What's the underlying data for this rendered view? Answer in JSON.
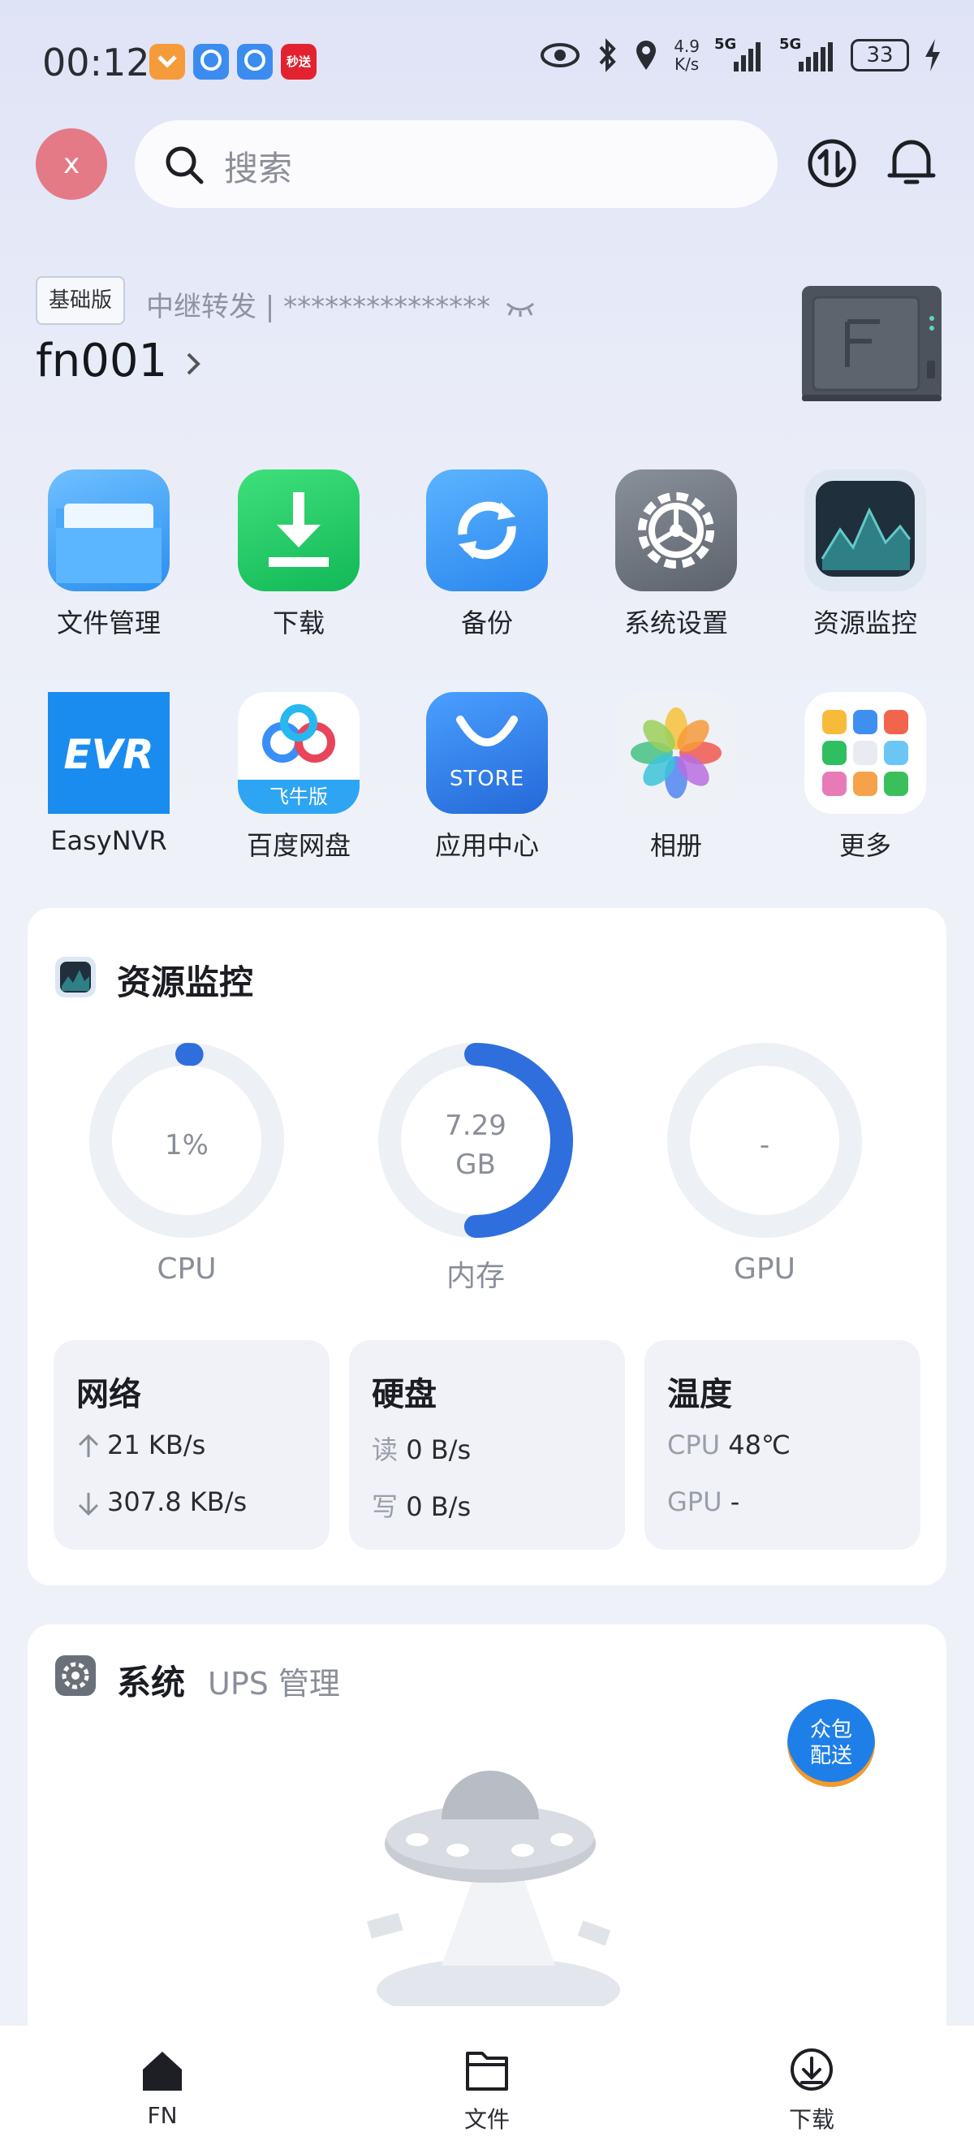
{
  "status_bar": {
    "time": "00:12",
    "apps": [
      {
        "label": "",
        "color": "#f59b3a"
      },
      {
        "label": "",
        "color": "#3c8cf0"
      },
      {
        "label": "",
        "color": "#3c8cf0"
      },
      {
        "label": "秒送",
        "color": "#e3222f"
      }
    ],
    "net_speed_value": "4.9",
    "net_speed_unit": "K/s",
    "signal_1": "5G",
    "signal_2": "5G",
    "battery": "33"
  },
  "top_bar": {
    "avatar_letter": "x",
    "search_placeholder": "搜索"
  },
  "header": {
    "badge": "基础版",
    "relay_text": "中继转发 | ***************",
    "device_name": "fn001"
  },
  "apps": [
    {
      "label": "文件管理",
      "icon": "folder-icon"
    },
    {
      "label": "下载",
      "icon": "download-icon"
    },
    {
      "label": "备份",
      "icon": "backup-icon"
    },
    {
      "label": "系统设置",
      "icon": "gear-icon"
    },
    {
      "label": "资源监控",
      "icon": "monitor-icon"
    },
    {
      "label": "EasyNVR",
      "icon": "easynvr-icon",
      "icon_text": "EVR"
    },
    {
      "label": "百度网盘",
      "icon": "baidu-netdisk-icon",
      "icon_text": "飞牛版"
    },
    {
      "label": "应用中心",
      "icon": "store-icon",
      "icon_text": "STORE"
    },
    {
      "label": "相册",
      "icon": "photos-icon"
    },
    {
      "label": "更多",
      "icon": "more-icon"
    }
  ],
  "resource_monitor": {
    "title": "资源监控",
    "gauges": [
      {
        "label": "CPU",
        "value_text": "1%",
        "percent": 1
      },
      {
        "label": "内存",
        "value_line1": "7.29",
        "value_line2": "GB",
        "percent": 50
      },
      {
        "label": "GPU",
        "value_text": "-",
        "percent": 0
      }
    ],
    "network": {
      "title": "网络",
      "up": "21 KB/s",
      "down": "307.8 KB/s"
    },
    "disk": {
      "title": "硬盘",
      "read_label": "读",
      "read": "0 B/s",
      "write_label": "写",
      "write": "0 B/s"
    },
    "temperature": {
      "title": "温度",
      "cpu_label": "CPU",
      "cpu": "48℃",
      "gpu_label": "GPU",
      "gpu": "-"
    }
  },
  "system_card": {
    "title": "系统",
    "subtitle": "UPS 管理",
    "crowd_badge_line1": "众包",
    "crowd_badge_line2": "配送"
  },
  "bottom_nav": [
    {
      "label": "FN",
      "icon": "home-icon"
    },
    {
      "label": "文件",
      "icon": "folder-outline-icon"
    },
    {
      "label": "下载",
      "icon": "cloud-download-icon"
    }
  ],
  "colors": {
    "accent": "#2e6fdd",
    "avatar": "#e47a85",
    "ring_track": "#edf0f5"
  }
}
